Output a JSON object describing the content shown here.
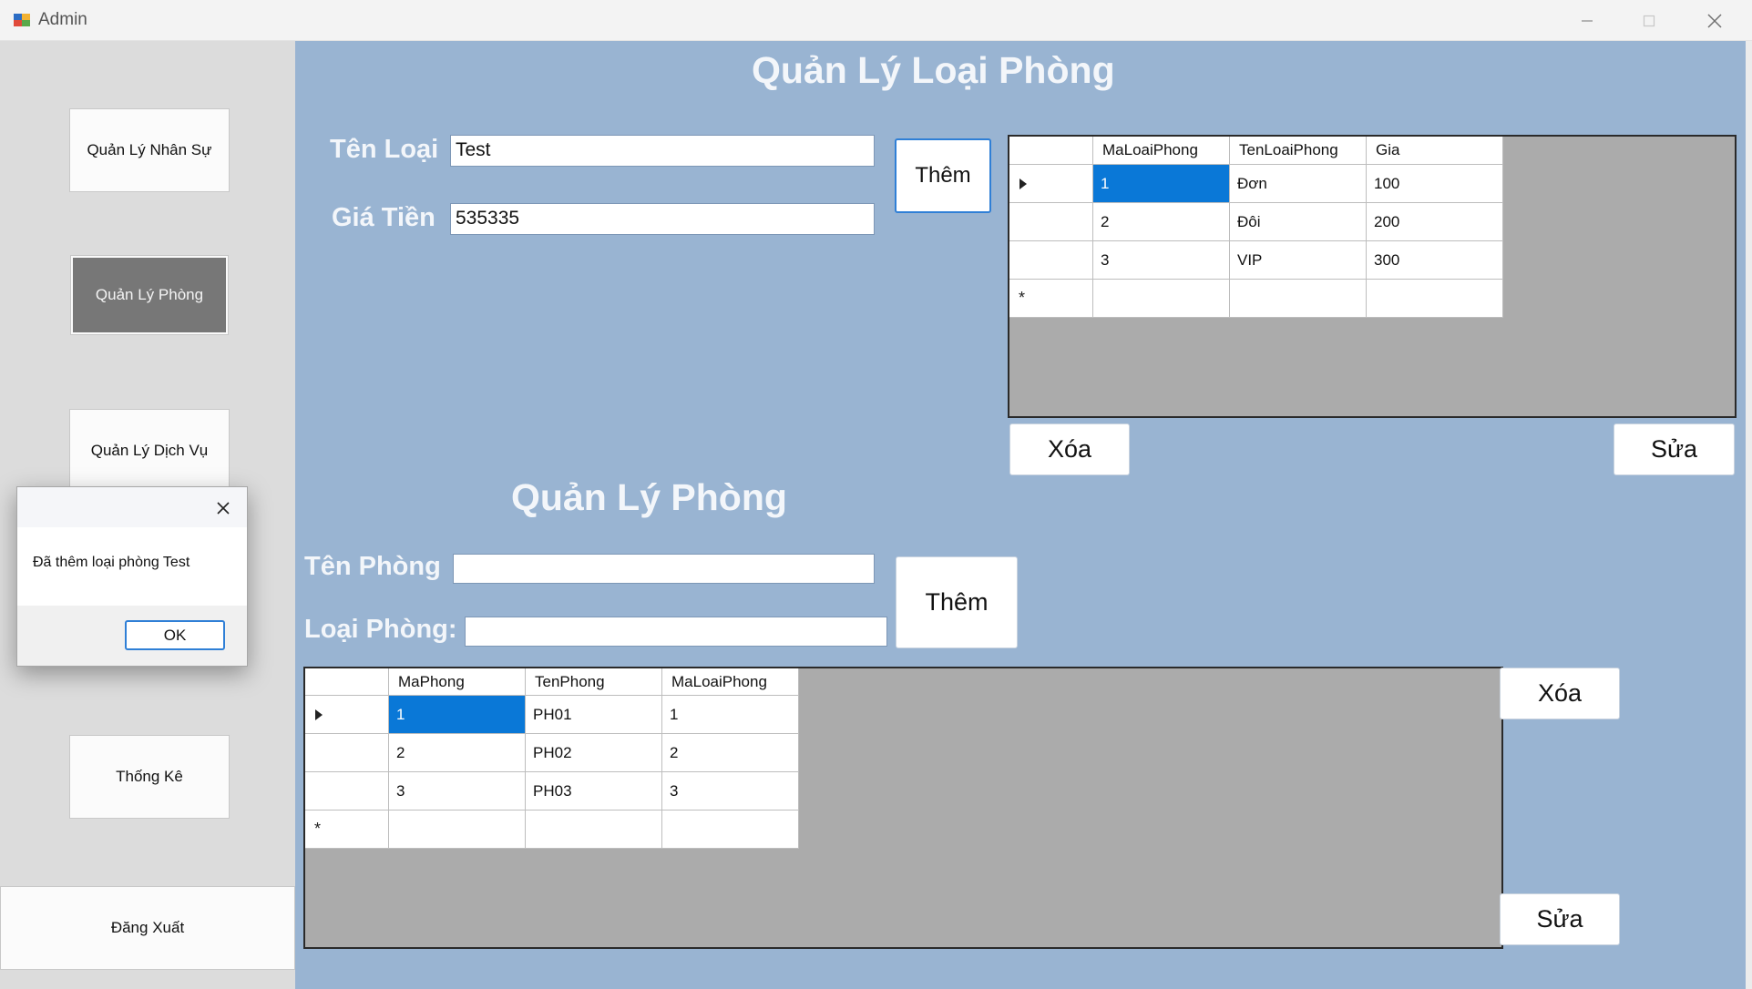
{
  "window": {
    "title": "Admin"
  },
  "sidebar": {
    "items": [
      {
        "label": "Quản Lý Nhân Sự"
      },
      {
        "label": "Quản Lý Phòng"
      },
      {
        "label": "Quản Lý Dịch Vụ"
      },
      {
        "label": "Thống Kê"
      },
      {
        "label": "Đăng Xuất"
      }
    ],
    "active_index": 1
  },
  "room_type": {
    "heading": "Quản Lý Loại Phòng",
    "name_label": "Tên Loại",
    "name_value": "Test",
    "price_label": "Giá Tiền",
    "price_value": "535335",
    "add_button": "Thêm",
    "delete_button": "Xóa",
    "edit_button": "Sửa",
    "grid": {
      "columns": [
        "MaLoaiPhong",
        "TenLoaiPhong",
        "Gia"
      ],
      "rows": [
        [
          "1",
          "Đơn",
          "100"
        ],
        [
          "2",
          "Đôi",
          "200"
        ],
        [
          "3",
          "VIP",
          "300"
        ]
      ]
    }
  },
  "room": {
    "heading": "Quản Lý Phòng",
    "name_label": "Tên Phòng",
    "name_value": "",
    "type_label": "Loại Phòng:",
    "type_value": "",
    "add_button": "Thêm",
    "delete_button": "Xóa",
    "edit_button": "Sửa",
    "grid": {
      "columns": [
        "MaPhong",
        "TenPhong",
        "MaLoaiPhong"
      ],
      "rows": [
        [
          "1",
          "PH01",
          "1"
        ],
        [
          "2",
          "PH02",
          "2"
        ],
        [
          "3",
          "PH03",
          "3"
        ]
      ]
    }
  },
  "dialog": {
    "message": "Đã thêm loại phòng Test",
    "ok_button": "OK"
  },
  "colors": {
    "main_bg": "#99b4d2",
    "sidebar_bg": "#dcdcdc",
    "selection": "#0a78d7",
    "active_nav": "#777777"
  }
}
